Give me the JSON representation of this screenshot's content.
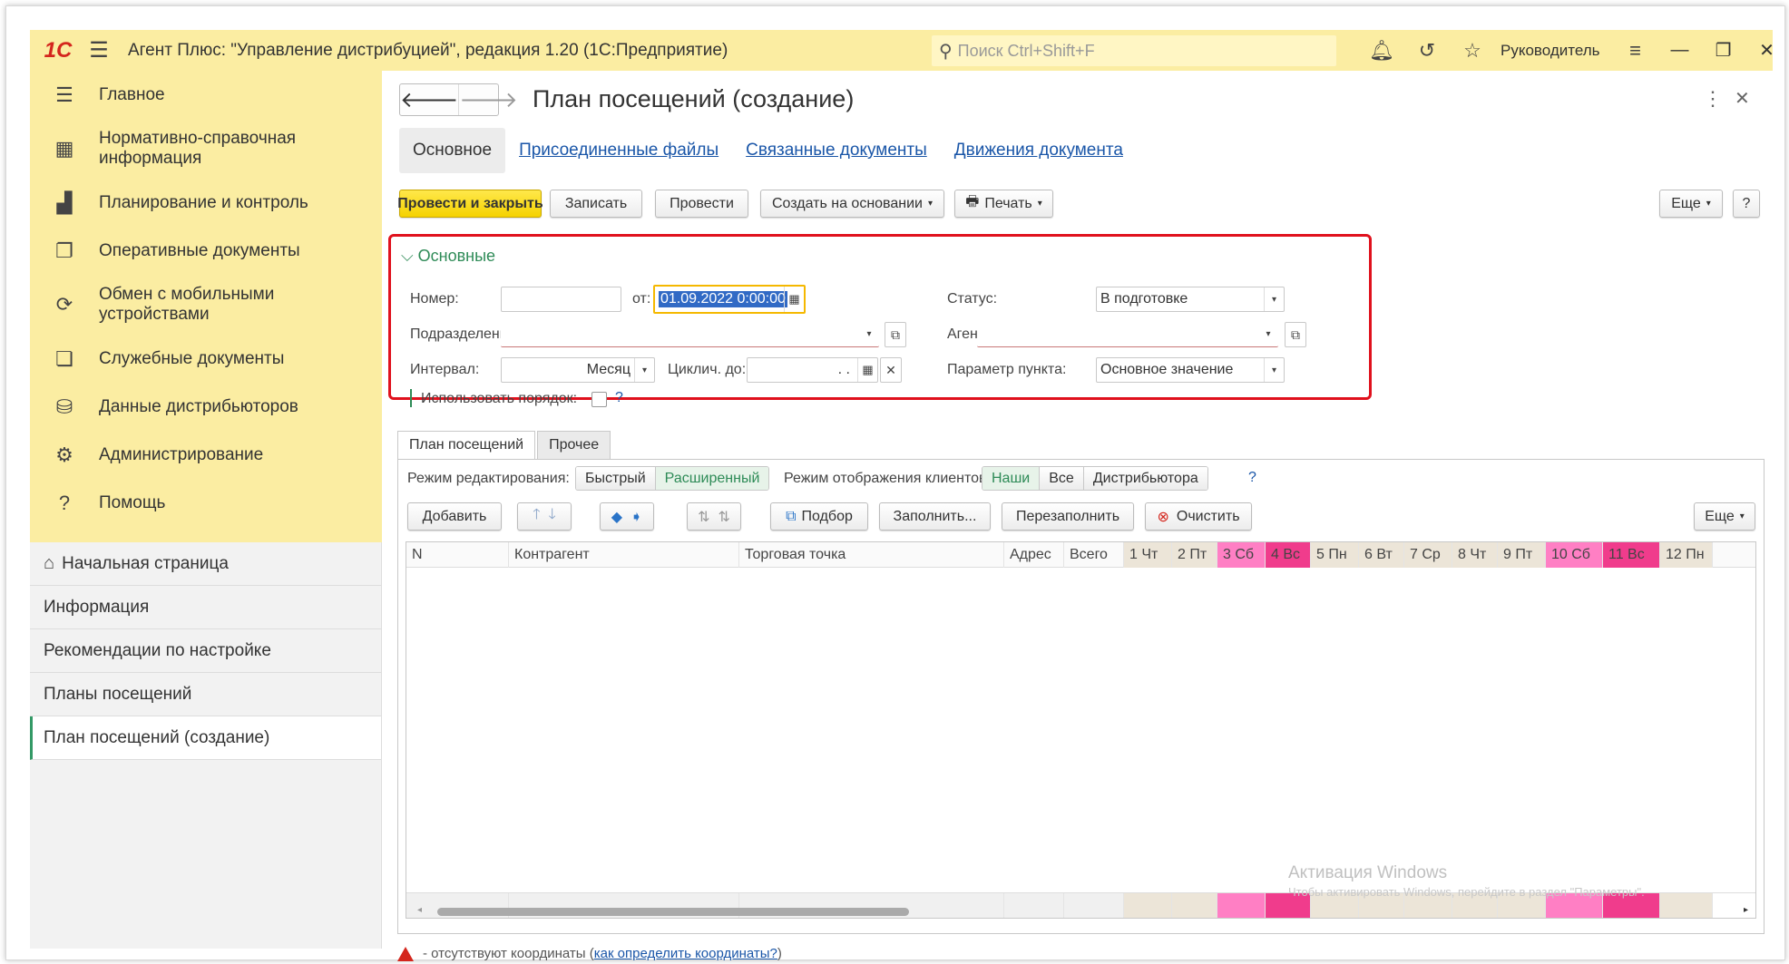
{
  "topbar": {
    "logo": "1С",
    "title": "Агент Плюс: \"Управление дистрибуцией\", редакция 1.20  (1С:Предприятие)",
    "search_placeholder": "Поиск Ctrl+Shift+F",
    "user": "Руководитель"
  },
  "sidebar": {
    "sections": [
      {
        "label": "Главное",
        "icon": "menu-icon"
      },
      {
        "label": "Нормативно-справочная информация",
        "icon": "catalog-icon"
      },
      {
        "label": "Планирование и контроль",
        "icon": "chart-icon"
      },
      {
        "label": "Оперативные документы",
        "icon": "documents-icon"
      },
      {
        "label": "Обмен с мобильными устройствами",
        "icon": "sync-icon"
      },
      {
        "label": "Служебные документы",
        "icon": "service-docs-icon"
      },
      {
        "label": "Данные дистрибьюторов",
        "icon": "distributor-icon"
      },
      {
        "label": "Администрирование",
        "icon": "gear-icon"
      },
      {
        "label": "Помощь",
        "icon": "help-icon"
      }
    ],
    "nav": [
      {
        "label": "Начальная страница"
      },
      {
        "label": "Информация"
      },
      {
        "label": "Рекомендации по настройке"
      },
      {
        "label": "Планы посещений"
      },
      {
        "label": "План посещений  (создание)"
      }
    ]
  },
  "form": {
    "title": "План посещений  (создание)",
    "tabs": [
      "Основное",
      "Присоединенные файлы",
      "Связанные документы",
      "Движения документа"
    ],
    "commands": {
      "post_close": "Провести и закрыть",
      "save": "Записать",
      "post": "Провести",
      "create_based": "Создать на основании",
      "print": "Печать",
      "more": "Еще",
      "help": "?"
    },
    "group": {
      "title": "Основные",
      "number_label": "Номер:",
      "number_value": "",
      "date_label": "от:",
      "date_value": "01.09.2022  0:00:00",
      "status_label": "Статус:",
      "status_value": "В подготовке",
      "division_label": "Подразделение:",
      "division_value": "",
      "agent_label": "Агент:",
      "agent_value": "",
      "interval_label": "Интервал:",
      "interval_value": "Месяц",
      "cycle_label": "Циклич. до:",
      "cycle_value": "  .  .",
      "point_param_label": "Параметр пункта:",
      "point_param_value": "Основное значение",
      "use_order_label": "Использовать порядок:",
      "use_order_help": "?"
    },
    "inner_tabs": [
      "План посещений",
      "Прочее"
    ],
    "edit_mode_label": "Режим редактирования:",
    "edit_modes": [
      "Быстрый",
      "Расширенный"
    ],
    "display_mode_label": "Режим отображения клиентов:",
    "display_modes": [
      "Наши",
      "Все",
      "Дистрибьютора"
    ],
    "display_help": "?",
    "grid_commands": {
      "add": "Добавить",
      "pick": "Подбор",
      "fill": "Заполнить...",
      "refill": "Перезаполнить",
      "clear": "Очистить",
      "more": "Еще"
    },
    "columns": [
      "N",
      "Контрагент",
      "Торговая точка",
      "Адрес",
      "Всего"
    ],
    "days": [
      {
        "label": "1 Чт",
        "type": "work"
      },
      {
        "label": "2 Пт",
        "type": "work"
      },
      {
        "label": "3 Сб",
        "type": "sat"
      },
      {
        "label": "4 Вс",
        "type": "sun"
      },
      {
        "label": "5 Пн",
        "type": "work"
      },
      {
        "label": "6 Вт",
        "type": "work"
      },
      {
        "label": "7 Ср",
        "type": "work"
      },
      {
        "label": "8 Чт",
        "type": "work"
      },
      {
        "label": "9 Пт",
        "type": "work"
      },
      {
        "label": "10 Сб",
        "type": "sat"
      },
      {
        "label": "11 Вс",
        "type": "sun"
      },
      {
        "label": "12 Пн",
        "type": "work"
      }
    ],
    "colors": {
      "work": "#ece5d8",
      "sat": "#ff7fc4",
      "sun": "#f03c8c"
    },
    "footer_text": " - отсутствуют координаты (",
    "footer_link": "как определить координаты?",
    "footer_close": ")"
  },
  "watermark": {
    "line1": "Активация Windows",
    "line2": "Чтобы активировать Windows, перейдите в раздел \"Параметры\"."
  }
}
